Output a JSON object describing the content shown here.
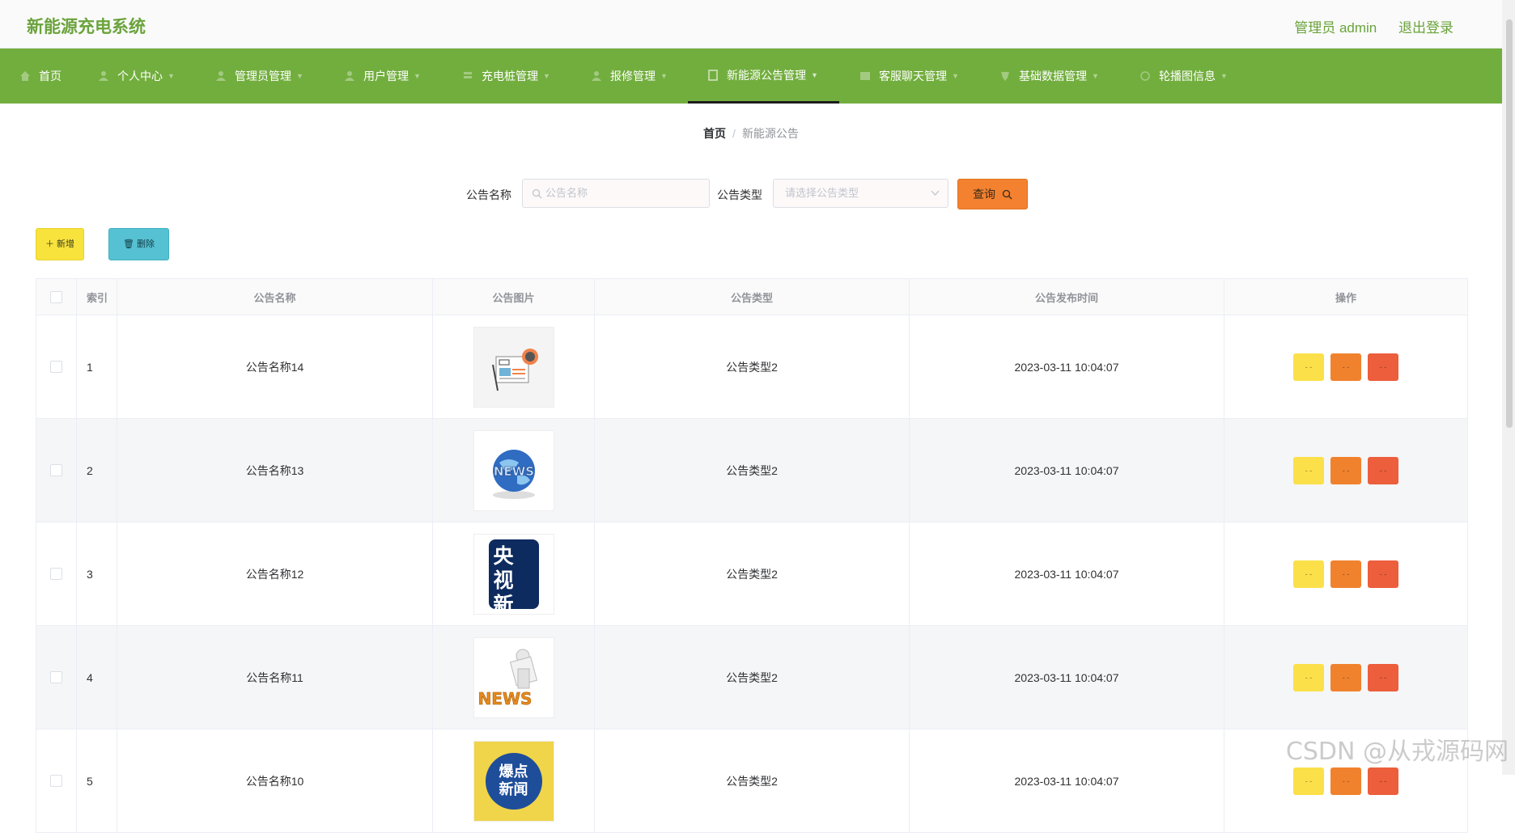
{
  "app": {
    "title": "新能源充电系统",
    "user": "管理员 admin",
    "logout": "退出登录"
  },
  "nav": [
    {
      "label": "首页",
      "icon": "home-icon"
    },
    {
      "label": "个人中心",
      "icon": "user-icon"
    },
    {
      "label": "管理员管理",
      "icon": "user-icon"
    },
    {
      "label": "用户管理",
      "icon": "user-icon"
    },
    {
      "label": "充电桩管理",
      "icon": "plug-icon"
    },
    {
      "label": "报修管理",
      "icon": "user-icon"
    },
    {
      "label": "新能源公告管理",
      "icon": "document-icon"
    },
    {
      "label": "客服聊天管理",
      "icon": "chat-icon"
    },
    {
      "label": "基础数据管理",
      "icon": "data-icon"
    },
    {
      "label": "轮播图信息",
      "icon": "image-icon"
    }
  ],
  "breadcrumb": {
    "home": "首页",
    "sep": "/",
    "current": "新能源公告"
  },
  "search": {
    "name_label": "公告名称",
    "name_placeholder": "公告名称",
    "type_label": "公告类型",
    "type_placeholder": "请选择公告类型",
    "query_label": "查询"
  },
  "actions": {
    "add": "新增",
    "delete": "删除"
  },
  "table": {
    "headers": [
      "索引",
      "公告名称",
      "公告图片",
      "公告类型",
      "公告发布时间",
      "操作"
    ],
    "rows": [
      {
        "index": "1",
        "name": "公告名称14",
        "image": "news-paper",
        "type": "公告类型2",
        "time": "2023-03-11 10:04:07"
      },
      {
        "index": "2",
        "name": "公告名称13",
        "image": "news-globe",
        "type": "公告类型2",
        "time": "2023-03-11 10:04:07"
      },
      {
        "index": "3",
        "name": "公告名称12",
        "image": "cctv-news",
        "image_text": "央视新闻",
        "type": "公告类型2",
        "time": "2023-03-11 10:04:07"
      },
      {
        "index": "4",
        "name": "公告名称11",
        "image": "news-figure",
        "type": "公告类型2",
        "time": "2023-03-11 10:04:07"
      },
      {
        "index": "5",
        "name": "公告名称10",
        "image": "hot-news",
        "image_text": "爆点新闻",
        "type": "公告类型2",
        "time": "2023-03-11 10:04:07"
      }
    ],
    "op_labels": [
      "- -",
      "- -",
      "- -"
    ]
  },
  "watermark": "CSDN @从戎源码网",
  "colors": {
    "brand": "#6aa33b",
    "nav": "#72ae3e",
    "query": "#f3812f",
    "add": "#f8e33d",
    "delete": "#56c1d2"
  }
}
